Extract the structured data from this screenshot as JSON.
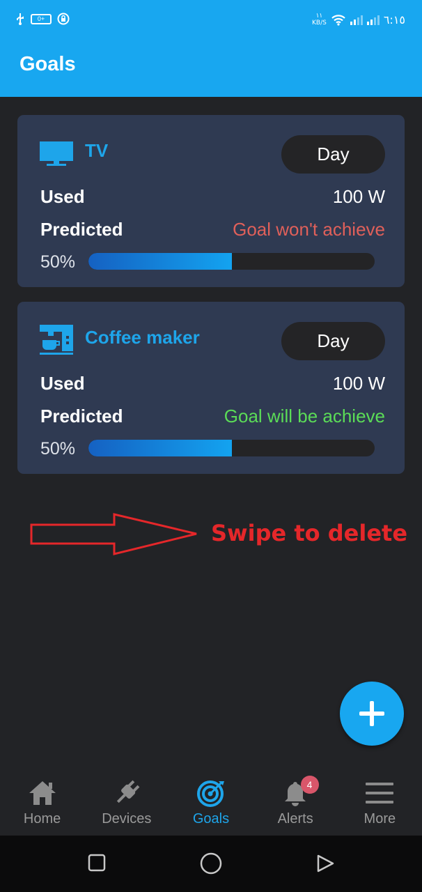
{
  "status_bar": {
    "net_speed_value": "۱۱",
    "net_speed_unit": "KB/S",
    "time": "٦:١٥",
    "battery_text": "0+"
  },
  "app_bar": {
    "title": "Goals"
  },
  "goals": [
    {
      "name": "TV",
      "icon": "tv-icon",
      "period": "Day",
      "used_label": "Used",
      "used_value": "100 W",
      "predicted_label": "Predicted",
      "predicted_value": "Goal won't achieve",
      "predicted_status_color": "#e0605a",
      "progress_text": "50%",
      "progress": 0.5
    },
    {
      "name": "Coffee maker",
      "icon": "coffee-maker-icon",
      "period": "Day",
      "used_label": "Used",
      "used_value": "100 W",
      "predicted_label": "Predicted",
      "predicted_value": "Goal will be achieve",
      "predicted_status_color": "#5bdc57",
      "progress_text": "50%",
      "progress": 0.5
    }
  ],
  "annotation": {
    "text": "Swipe to delete",
    "color": "#e5272a"
  },
  "fab": {
    "icon": "plus-icon"
  },
  "bottom_nav": [
    {
      "label": "Home",
      "icon": "home-icon"
    },
    {
      "label": "Devices",
      "icon": "plug-icon"
    },
    {
      "label": "Goals",
      "icon": "target-icon",
      "active": true
    },
    {
      "label": "Alerts",
      "icon": "bell-icon",
      "badge": "4"
    },
    {
      "label": "More",
      "icon": "menu-icon"
    }
  ],
  "colors": {
    "accent": "#18a7f0",
    "card": "#2f3a52",
    "background": "#222326"
  }
}
